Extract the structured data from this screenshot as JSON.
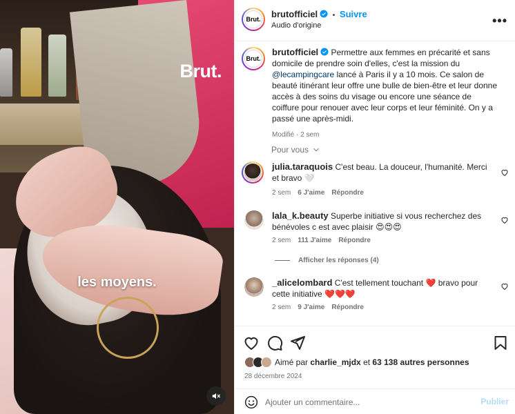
{
  "media": {
    "logo_text": "Brut.",
    "caption": "les moyens."
  },
  "header": {
    "avatar_text": "Brut.",
    "username": "brutofficiel",
    "separator": "•",
    "follow_label": "Suivre",
    "audio": "Audio d'origine",
    "more": "•••"
  },
  "post": {
    "avatar_text": "Brut.",
    "username": "brutofficiel",
    "text_before": "Permettre aux femmes en précarité et sans domicile de prendre soin d'elles, c'est la mission du ",
    "mention": "@lecampingcare",
    "text_after": " lancé à Paris il y a 10 mois. Ce salon de beauté itinérant leur offre une bulle de bien-être et leur donne accès à des soins du visage ou encore une séance de coiffure pour renouer avec leur corps et leur féminité. On y a passé une après-midi.",
    "meta": "Modifié · 2 sem"
  },
  "pour_vous": "Pour vous",
  "comments": [
    {
      "username": "julia.taraquois",
      "text": "C'est beau. La douceur, l'humanité. Merci et bravo 🤍",
      "time": "2 sem",
      "likes": "6 J'aime",
      "reply": "Répondre"
    },
    {
      "username": "lala_k.beauty",
      "text": "Superbe initiative si vous recherchez des bénévoles c est avec plaisir 😍😍😍",
      "time": "2 sem",
      "likes": "111 J'aime",
      "reply": "Répondre"
    },
    {
      "username": "_alicelombard",
      "text": "C'est tellement touchant ❤️ bravo pour cette initiative ❤️❤️❤️",
      "time": "2 sem",
      "likes": "9 J'aime",
      "reply": "Répondre"
    }
  ],
  "view_replies": "Afficher les réponses (4)",
  "likes": {
    "prefix": "Aimé par ",
    "user": "charlie_mjdx",
    "middle": " et ",
    "count": "63 138 autres personnes"
  },
  "date": "28 décembre 2024",
  "add_comment": {
    "placeholder": "Ajouter un commentaire...",
    "publish_label": "Publier"
  },
  "colors": {
    "accent": "#0095f6",
    "verified": "#0095f6",
    "mention": "#00376b",
    "publish_disabled": "#b3dbff"
  }
}
